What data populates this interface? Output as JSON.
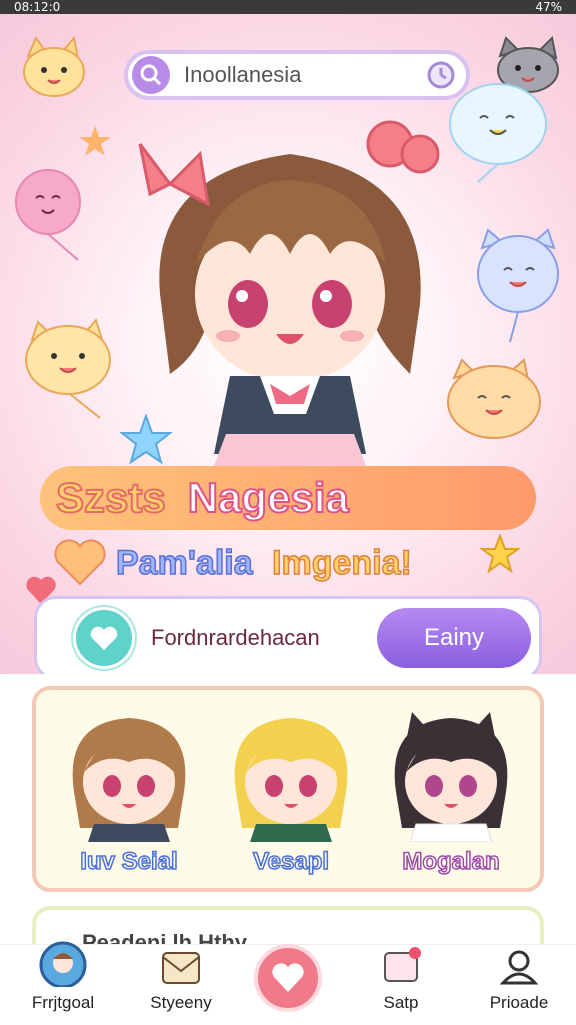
{
  "status_bar": {
    "time": "08:12:0",
    "battery": "47%"
  },
  "search": {
    "text": "Inoollanesia"
  },
  "banner": {
    "word1": "Szsts",
    "word2": "Nagesia"
  },
  "subtitle": {
    "part1": "Pam'alia",
    "part2": "Imgenia!"
  },
  "action_bar": {
    "text": "Fordnrardehacan",
    "button_label": "Eainy"
  },
  "characters": [
    {
      "name": "Iuv Seial",
      "hair": "#b07a4a",
      "eyes": "#c7426f",
      "accent": "#6fbf8f"
    },
    {
      "name": "Vesapl",
      "hair": "#f4d04f",
      "eyes": "#c7426f",
      "accent": "#e98a9a"
    },
    {
      "name": "Mogalan",
      "hair": "#3a3036",
      "eyes": "#b0478c",
      "accent": "#f3a0b5"
    }
  ],
  "second_card": {
    "title": "Peadenj lh Hthy"
  },
  "tabs": [
    {
      "label": "Frrjtgoal",
      "icon": "avatar-icon"
    },
    {
      "label": "Styeeny",
      "icon": "mail-icon"
    },
    {
      "label": "Satp",
      "icon": "chat-icon"
    },
    {
      "label": "Prioade",
      "icon": "profile-icon"
    }
  ],
  "colors": {
    "accent_purple": "#9b6be8",
    "accent_teal": "#5fd3c9",
    "heart_red": "#f07a88"
  }
}
